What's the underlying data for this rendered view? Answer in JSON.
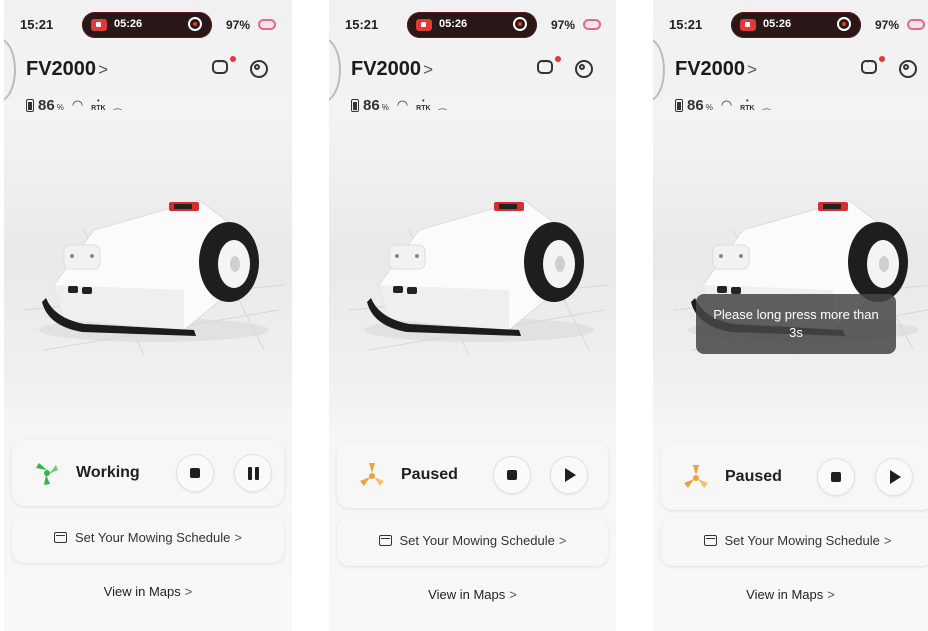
{
  "screens": [
    {
      "status_bar": {
        "time": "15:21",
        "record_time": "05:26",
        "battery": "97%"
      },
      "device": {
        "name": "FV2000",
        "chevron": ">"
      },
      "stats": {
        "battery_value": "86",
        "battery_unit": "%"
      },
      "status": {
        "label": "Working",
        "state_icon": "fan-working-icon",
        "action_icon": "pause-icon"
      },
      "schedule": {
        "label": "Set Your Mowing Schedule",
        "chevron": ">"
      },
      "maps": {
        "label": "View in Maps",
        "chevron": ">"
      }
    },
    {
      "status_bar": {
        "time": "15:21",
        "record_time": "05:26",
        "battery": "97%"
      },
      "device": {
        "name": "FV2000",
        "chevron": ">"
      },
      "stats": {
        "battery_value": "86",
        "battery_unit": "%"
      },
      "status": {
        "label": "Paused",
        "state_icon": "fan-paused-icon",
        "action_icon": "play-icon"
      },
      "schedule": {
        "label": "Set Your Mowing Schedule",
        "chevron": ">"
      },
      "maps": {
        "label": "View in Maps",
        "chevron": ">"
      }
    },
    {
      "status_bar": {
        "time": "15:21",
        "record_time": "05:26",
        "battery": "97%"
      },
      "device": {
        "name": "FV2000",
        "chevron": ">"
      },
      "stats": {
        "battery_value": "86",
        "battery_unit": "%"
      },
      "status": {
        "label": "Paused",
        "state_icon": "fan-paused-icon",
        "action_icon": "play-icon"
      },
      "schedule": {
        "label": "Set Your Mowing Schedule",
        "chevron": ">"
      },
      "maps": {
        "label": "View in Maps",
        "chevron": ">"
      },
      "toast": {
        "message": "Please long press more than 3s"
      }
    }
  ],
  "colors": {
    "working_green": "#37b24d",
    "paused_orange": "#f0a040",
    "record_red": "#e53935"
  }
}
